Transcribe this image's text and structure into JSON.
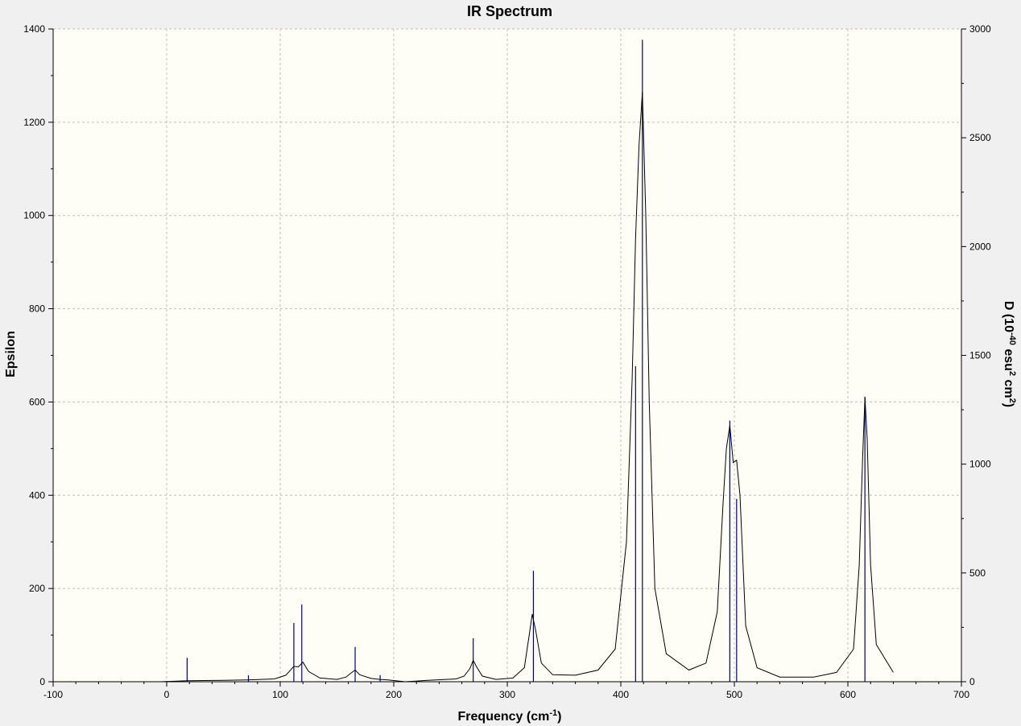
{
  "chart_data": {
    "type": "line",
    "title": "IR Spectrum",
    "xlabel": "Frequency (cm",
    "xlabel_sup": "-1",
    "xlabel_end": ")",
    "ylabel_left": "Epsilon",
    "ylabel_right": "D (10",
    "ylabel_right_sup1": "-40",
    "ylabel_right_mid": " esu",
    "ylabel_right_sup2": "2",
    "ylabel_right_mid2": " cm",
    "ylabel_right_sup3": "2",
    "ylabel_right_end": ")",
    "xlim": [
      -100,
      700
    ],
    "ylim_left": [
      0,
      1400
    ],
    "ylim_right": [
      0,
      3000
    ],
    "x_ticks": [
      -100,
      0,
      100,
      200,
      300,
      400,
      500,
      600,
      700
    ],
    "y_left_ticks": [
      0,
      200,
      400,
      600,
      800,
      1000,
      1200,
      1400
    ],
    "y_right_ticks": [
      0,
      500,
      1000,
      1500,
      2000,
      2500,
      3000
    ],
    "grid": true,
    "colors": {
      "plot_background": "#fefef6",
      "spectrum": "#000000",
      "sticks": "#00007f",
      "grid": "#bfbfbf"
    },
    "series": [
      {
        "x": [
          -5,
          18,
          50,
          71,
          95,
          105,
          112,
          116,
          120,
          125,
          135,
          150,
          158,
          162,
          166,
          170,
          180,
          188,
          195,
          210,
          230,
          255,
          262,
          267,
          270,
          273,
          278,
          290,
          305,
          315,
          319,
          322,
          325,
          330,
          340,
          360,
          380,
          395,
          405,
          410,
          413,
          416,
          419,
          422,
          425,
          430,
          440,
          460,
          475,
          485,
          490,
          493,
          496,
          499,
          502,
          505,
          510,
          520,
          540,
          570,
          590,
          605,
          610,
          613,
          615,
          617,
          620,
          625,
          640
        ],
        "values": [
          0,
          2,
          3,
          4,
          6,
          14,
          33,
          32,
          42,
          22,
          8,
          5,
          10,
          18,
          25,
          15,
          7,
          5,
          4,
          0,
          3,
          6,
          12,
          28,
          46,
          32,
          12,
          5,
          8,
          30,
          95,
          145,
          110,
          40,
          15,
          14,
          25,
          70,
          300,
          650,
          950,
          1150,
          1265,
          1000,
          600,
          200,
          60,
          25,
          40,
          150,
          380,
          500,
          550,
          470,
          475,
          400,
          120,
          30,
          10,
          10,
          20,
          70,
          250,
          480,
          610,
          520,
          250,
          80,
          20
        ]
      },
      {
        "sticks_x": [
          18,
          72,
          112,
          119,
          166,
          188,
          270,
          323,
          413,
          419,
          496,
          502,
          615
        ],
        "sticks_values": [
          110,
          30,
          270,
          355,
          160,
          30,
          200,
          510,
          1450,
          2950,
          1200,
          840,
          1310
        ]
      }
    ]
  }
}
